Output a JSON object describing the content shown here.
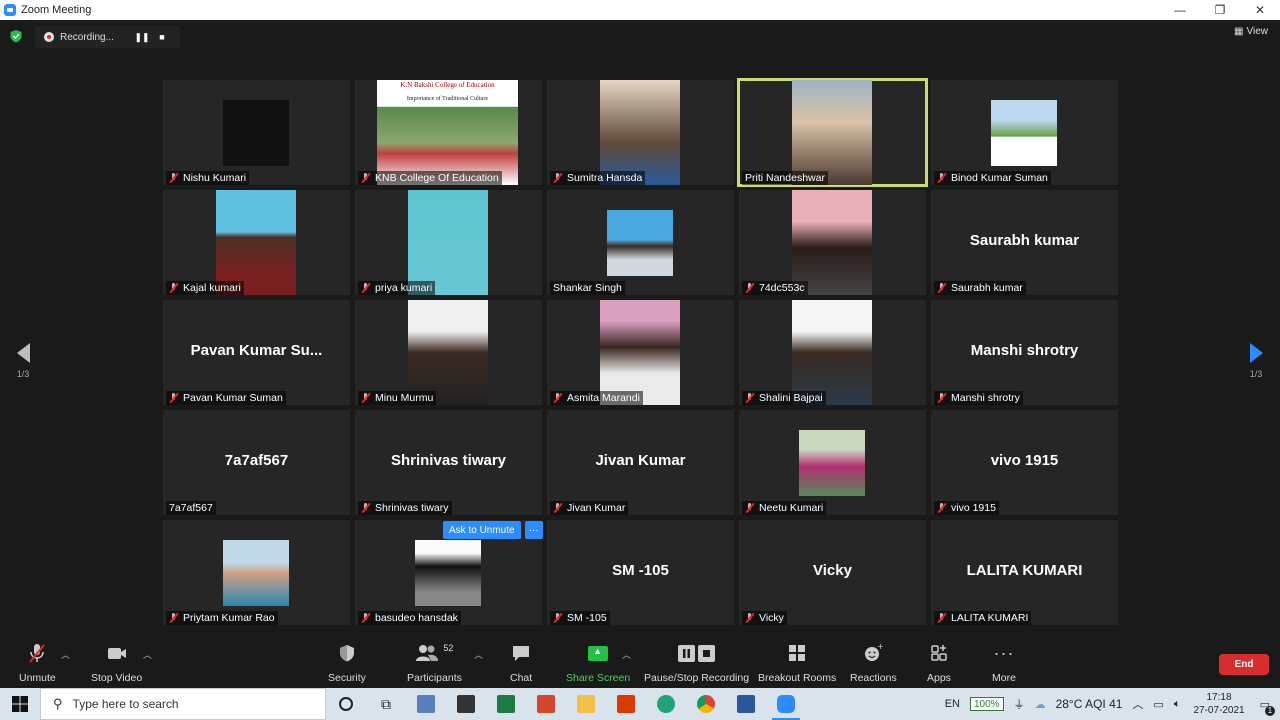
{
  "window": {
    "title": "Zoom Meeting"
  },
  "recording": {
    "label": "Recording..."
  },
  "view": {
    "label": "View"
  },
  "pagination": {
    "left": "1/3",
    "right": "1/3"
  },
  "participants": [
    {
      "name": "Nishu Kumari",
      "display": "",
      "video": "photo",
      "muted": true
    },
    {
      "name": "KNB College Of Education",
      "display": "",
      "video": "photo",
      "muted": true
    },
    {
      "name": "Sumitra Hansda",
      "display": "",
      "video": "photo",
      "muted": true
    },
    {
      "name": "Priti Nandeshwar",
      "display": "",
      "video": "photo",
      "muted": false,
      "active": true
    },
    {
      "name": "Binod Kumar Suman",
      "display": "",
      "video": "photo",
      "muted": true
    },
    {
      "name": "Kajal kumari",
      "display": "",
      "video": "photo",
      "muted": true
    },
    {
      "name": "priya kumari",
      "display": "",
      "video": "photo",
      "muted": true
    },
    {
      "name": "Shankar Singh",
      "display": "",
      "video": "photo",
      "muted": false
    },
    {
      "name": "74dc553c",
      "display": "",
      "video": "photo",
      "muted": true
    },
    {
      "name": "Saurabh kumar",
      "display": "Saurabh kumar",
      "video": "none",
      "muted": true
    },
    {
      "name": "Pavan Kumar Suman",
      "display": "Pavan Kumar Su...",
      "video": "none",
      "muted": true
    },
    {
      "name": "Minu Murmu",
      "display": "",
      "video": "photo",
      "muted": true
    },
    {
      "name": "Asmita Marandi",
      "display": "",
      "video": "photo",
      "muted": true
    },
    {
      "name": "Shalini Bajpai",
      "display": "",
      "video": "photo",
      "muted": true
    },
    {
      "name": "Manshi shrotry",
      "display": "Manshi shrotry",
      "video": "none",
      "muted": true
    },
    {
      "name": "7a7af567",
      "display": "7a7af567",
      "video": "none",
      "muted": false
    },
    {
      "name": "Shrinivas tiwary",
      "display": "Shrinivas tiwary",
      "video": "none",
      "muted": true
    },
    {
      "name": "Jivan Kumar",
      "display": "Jivan Kumar",
      "video": "none",
      "muted": true
    },
    {
      "name": "Neetu Kumari",
      "display": "",
      "video": "photo",
      "muted": true
    },
    {
      "name": "vivo 1915",
      "display": "vivo 1915",
      "video": "none",
      "muted": true
    },
    {
      "name": "Priytam Kumar Rao",
      "display": "",
      "video": "photo",
      "muted": true
    },
    {
      "name": "basudeo hansdak",
      "display": "",
      "video": "photo",
      "muted": true
    },
    {
      "name": "SM -105",
      "display": "SM -105",
      "video": "none",
      "muted": true
    },
    {
      "name": "Vicky",
      "display": "Vicky",
      "video": "none",
      "muted": true
    },
    {
      "name": "LALITA KUMARI",
      "display": "LALITA KUMARI",
      "video": "none",
      "muted": true
    }
  ],
  "knb_slide": {
    "line1": "K.N Bakshi College of Education",
    "line2": "Importance of Traditional Culture"
  },
  "hover_popup": {
    "ask": "Ask to Unmute",
    "more": "···"
  },
  "toolbar": {
    "unmute": "Unmute",
    "stop_video": "Stop Video",
    "security": "Security",
    "participants": "Participants",
    "participant_count": "52",
    "chat": "Chat",
    "share_screen": "Share Screen",
    "pause_stop_recording": "Pause/Stop Recording",
    "breakout_rooms": "Breakout Rooms",
    "reactions": "Reactions",
    "apps": "Apps",
    "more": "More",
    "end": "End"
  },
  "taskbar": {
    "search_placeholder": "Type here to search",
    "language": "EN",
    "battery": "100%",
    "weather": "28°C  AQI 41",
    "time": "17:18",
    "date": "27-07-2021",
    "notifications": "1"
  },
  "colors": {
    "accent": "#2d8cff",
    "active_speaker": "#c7e06c",
    "end": "#d92c2c",
    "share": "#22c147"
  }
}
